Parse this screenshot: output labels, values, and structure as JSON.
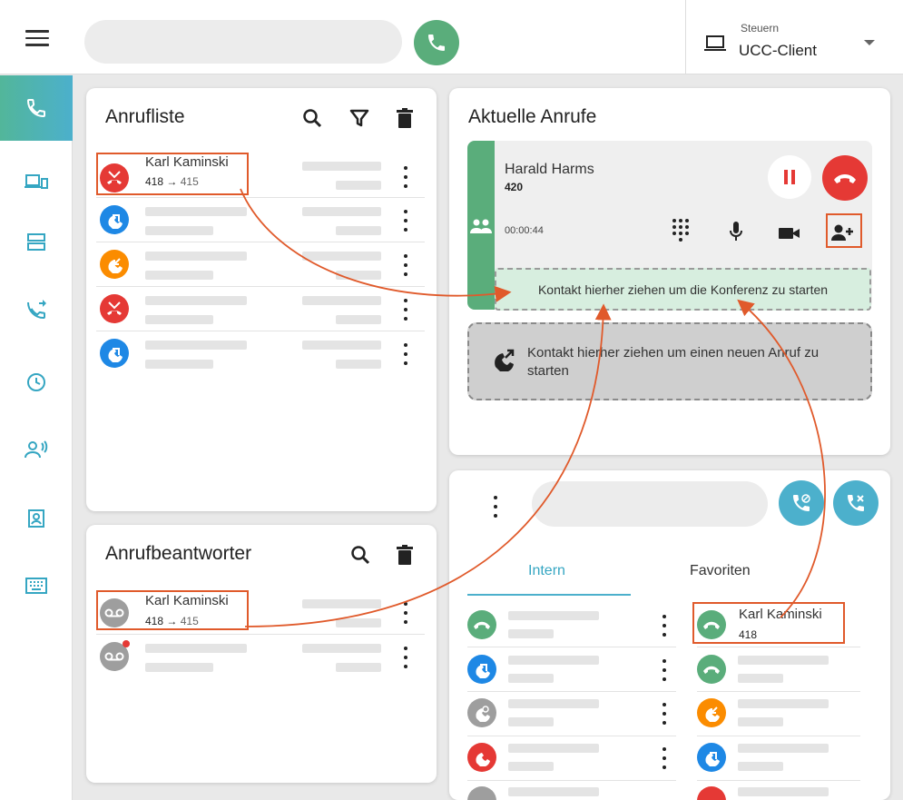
{
  "header": {
    "control_label": "Steuern",
    "control_value": "UCC-Client"
  },
  "call_list": {
    "title": "Anrufliste",
    "entries": [
      {
        "name": "Karl Kaminski",
        "from": "418",
        "arrow": "→",
        "to": "415",
        "status": "missed",
        "color": "#e53935"
      },
      {
        "status": "outgoing",
        "color": "#1e88e5"
      },
      {
        "status": "incoming",
        "color": "#fb8c00"
      },
      {
        "status": "missed",
        "color": "#e53935"
      },
      {
        "status": "outgoing",
        "color": "#1e88e5"
      }
    ]
  },
  "voicemail": {
    "title": "Anrufbeantworter",
    "entries": [
      {
        "name": "Karl Kaminski",
        "from": "418",
        "arrow": "→",
        "to": "415",
        "color": "#9e9e9e"
      },
      {
        "color": "#9e9e9e",
        "unread": true
      }
    ]
  },
  "current_calls": {
    "title": "Aktuelle Anrufe",
    "caller_name": "Harald Harms",
    "caller_number": "420",
    "duration": "00:00:44",
    "drop_conference": "Kontakt hierher ziehen um die Konferenz zu starten",
    "drop_new_call": "Kontakt hierher ziehen um einen neuen Anruf zu starten"
  },
  "contacts": {
    "tabs": [
      "Intern",
      "Favoriten"
    ],
    "active_tab": "Intern",
    "favorite": {
      "name": "Karl Kaminski",
      "number": "418"
    }
  },
  "colors": {
    "accent": "#4cb0cc",
    "green": "#5aad7b",
    "red": "#e53935",
    "highlight": "#e05a2b"
  }
}
